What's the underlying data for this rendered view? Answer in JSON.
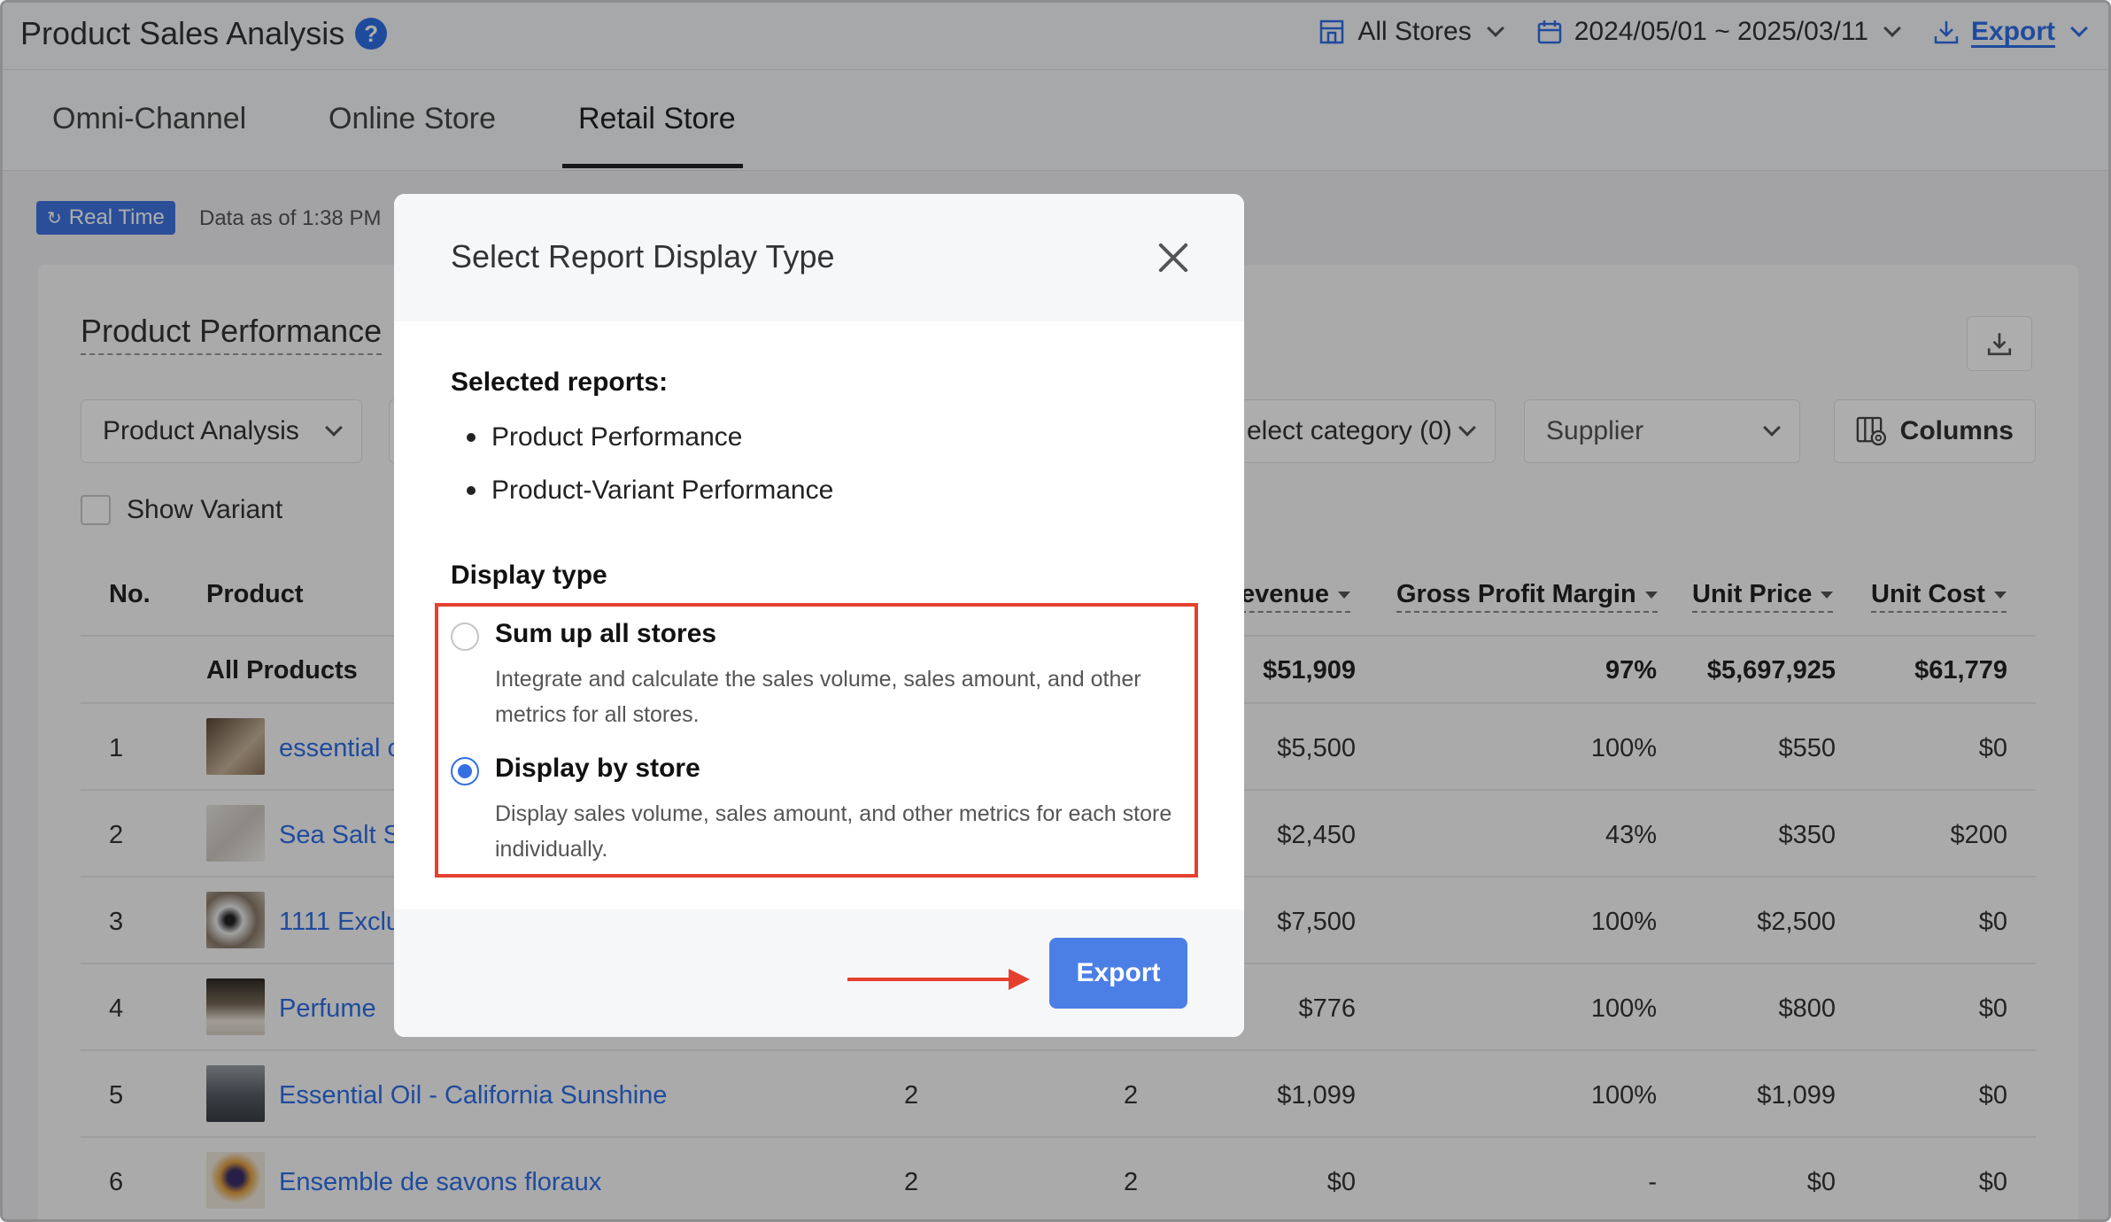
{
  "header": {
    "title": "Product Sales Analysis",
    "stores": "All Stores",
    "date_range": "2024/05/01 ~ 2025/03/11",
    "export_label": "Export"
  },
  "tabs": [
    {
      "label": "Omni-Channel"
    },
    {
      "label": "Online Store"
    },
    {
      "label": "Retail Store",
      "active": true
    }
  ],
  "status": {
    "realtime_badge": "Real Time",
    "data_as_of": "Data as of 1:38 PM"
  },
  "card": {
    "title": "Product Performance",
    "analysis_select": "Product Analysis",
    "category_select": "elect category (0)",
    "supplier_select": "Supplier",
    "columns_label": "Columns",
    "show_variant_label": "Show Variant"
  },
  "table": {
    "headers": {
      "no": "No.",
      "product": "Product",
      "revenue": "evenue",
      "gross_margin": "Gross Profit Margin",
      "unit_price": "Unit Price",
      "unit_cost": "Unit Cost"
    },
    "totals": {
      "label": "All Products",
      "revenue": "$51,909",
      "margin": "97%",
      "unit_price": "$5,697,925",
      "unit_cost": "$61,779"
    },
    "rows": [
      {
        "no": "1",
        "product": "essential c",
        "qty1": "",
        "qty2": "",
        "revenue": "$5,500",
        "margin": "100%",
        "unit_price": "$550",
        "unit_cost": "$0"
      },
      {
        "no": "2",
        "product": "Sea Salt Sc",
        "qty1": "",
        "qty2": "",
        "revenue": "$2,450",
        "margin": "43%",
        "unit_price": "$350",
        "unit_cost": "$200"
      },
      {
        "no": "3",
        "product": "1111 Exclu",
        "qty1": "",
        "qty2": "",
        "revenue": "$7,500",
        "margin": "100%",
        "unit_price": "$2,500",
        "unit_cost": "$0"
      },
      {
        "no": "4",
        "product": "Perfume",
        "qty1": "",
        "qty2": "",
        "revenue": "$776",
        "margin": "100%",
        "unit_price": "$800",
        "unit_cost": "$0"
      },
      {
        "no": "5",
        "product": "Essential Oil - California Sunshine",
        "qty1": "2",
        "qty2": "2",
        "revenue": "$1,099",
        "margin": "100%",
        "unit_price": "$1,099",
        "unit_cost": "$0"
      },
      {
        "no": "6",
        "product": "Ensemble de savons floraux",
        "qty1": "2",
        "qty2": "2",
        "revenue": "$0",
        "margin": "-",
        "unit_price": "$0",
        "unit_cost": "$0"
      }
    ]
  },
  "modal": {
    "title": "Select Report Display Type",
    "selected_reports_label": "Selected reports:",
    "reports": [
      "Product Performance",
      "Product-Variant Performance"
    ],
    "display_type_label": "Display type",
    "options": [
      {
        "title": "Sum up all stores",
        "desc": "Integrate and calculate the sales volume, sales amount, and other metrics for all stores.",
        "selected": false
      },
      {
        "title": "Display by store",
        "desc": "Display sales volume, sales amount, and other metrics for each store individually.",
        "selected": true
      }
    ],
    "export_button": "Export"
  },
  "colors": {
    "accent": "#2f6fe6",
    "highlight_box": "#e5402f",
    "overlay": "rgba(0,0,0,0.32)"
  }
}
